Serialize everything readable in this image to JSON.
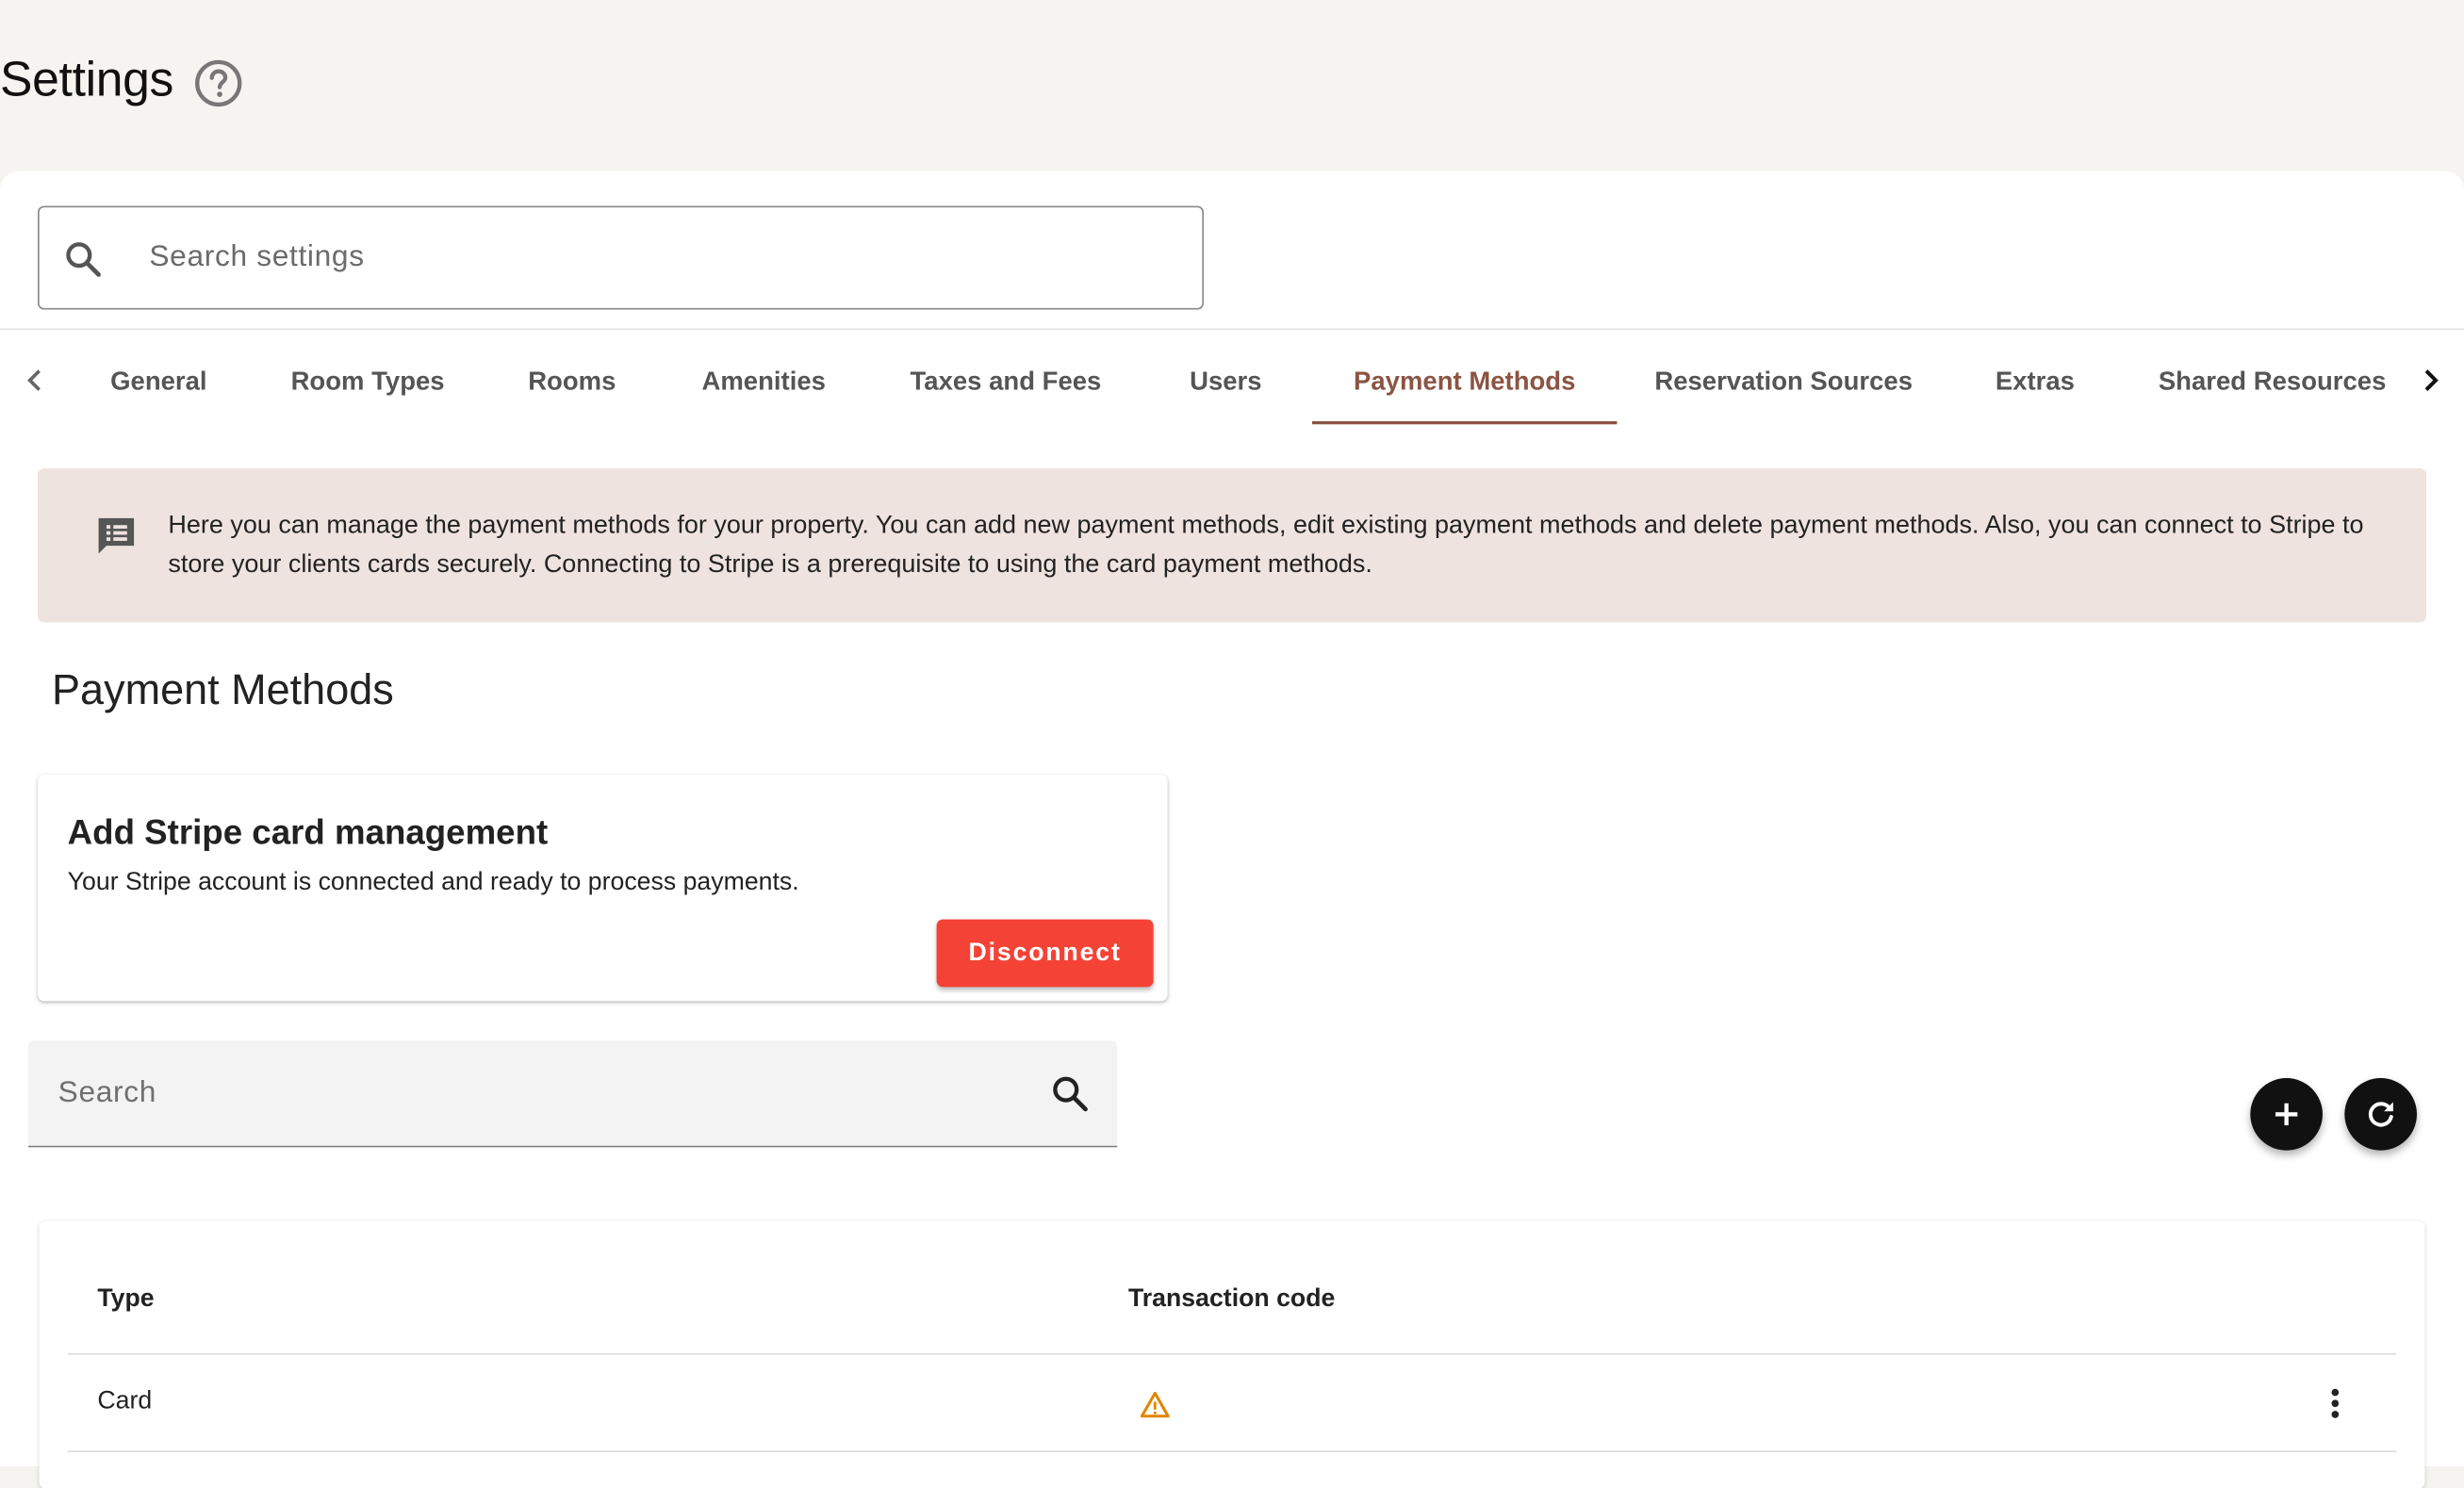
{
  "page": {
    "title": "Settings",
    "help_icon": "help-circle-icon"
  },
  "settings_search": {
    "placeholder": "Search settings",
    "value": "",
    "icon": "search-icon"
  },
  "tabs": {
    "prev_icon": "chevron-left-icon",
    "next_icon": "chevron-right-icon",
    "items": [
      {
        "label": "General",
        "active": false
      },
      {
        "label": "Room Types",
        "active": false
      },
      {
        "label": "Rooms",
        "active": false
      },
      {
        "label": "Amenities",
        "active": false
      },
      {
        "label": "Taxes and Fees",
        "active": false
      },
      {
        "label": "Users",
        "active": false
      },
      {
        "label": "Payment Methods",
        "active": true
      },
      {
        "label": "Reservation Sources",
        "active": false
      },
      {
        "label": "Extras",
        "active": false
      },
      {
        "label": "Shared Resources",
        "active": false
      }
    ]
  },
  "info_banner": {
    "icon": "message-list-icon",
    "text": "Here you can manage the payment methods for your property. You can add new payment methods, edit existing payment methods and delete payment methods. Also, you can connect to Stripe to store your clients cards securely. Connecting to Stripe is a prerequisite to using the card payment methods."
  },
  "section": {
    "title": "Payment Methods"
  },
  "stripe_card": {
    "title": "Add Stripe card management",
    "description": "Your Stripe account is connected and ready to process payments.",
    "button_label": "Disconnect"
  },
  "table_search": {
    "placeholder": "Search",
    "value": "",
    "icon": "search-icon"
  },
  "actions": {
    "add_icon": "plus-icon",
    "refresh_icon": "refresh-icon"
  },
  "table": {
    "columns": [
      "Type",
      "Transaction code"
    ],
    "rows": [
      {
        "type": "Card",
        "transaction_code_icon": "warning-icon",
        "menu_icon": "more-vertical-icon"
      }
    ]
  },
  "colors": {
    "accent": "#8b5443",
    "banner_bg": "#efe3e0",
    "danger": "#f44336",
    "warning": "#e08600",
    "page_bg": "#f5f4f1"
  }
}
